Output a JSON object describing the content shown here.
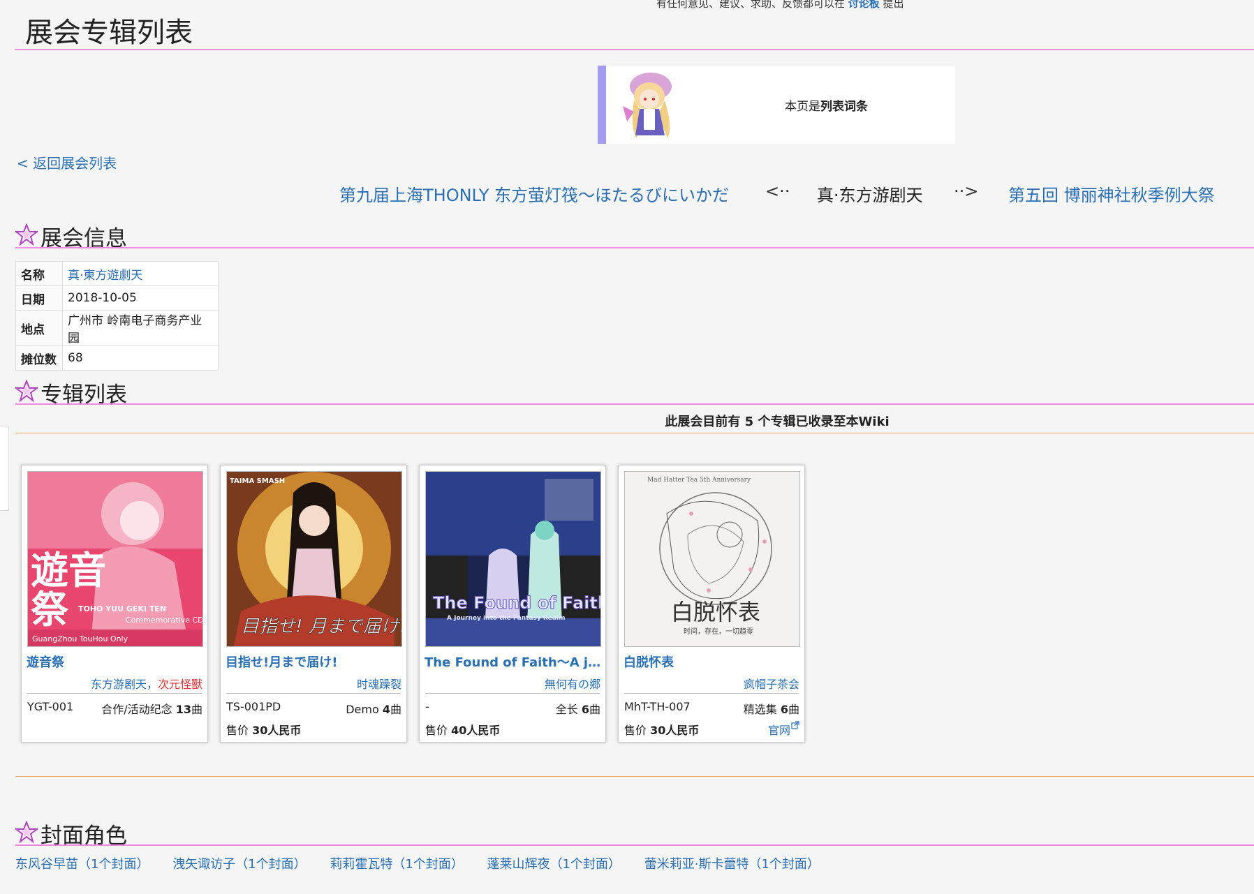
{
  "top_note": {
    "prefix": "有任何意见、建议、求助、反馈都可以在 ",
    "link": "讨论板",
    "suffix": " 提出"
  },
  "page_title": "展会专辑列表",
  "notice": {
    "prefix": "本页是",
    "bold": "列表词条"
  },
  "back_link": "< 返回展会列表",
  "event_chain": {
    "prev": "第九届上海THONLY 东方萤灯筏～ほたるびにいかだ",
    "prev_arrow": "<··",
    "current": "真·东方游剧天",
    "next_arrow": "··>",
    "next": "第五回 博丽神社秋季例大祭"
  },
  "section_info": {
    "heading": "展会信息"
  },
  "info_table": [
    {
      "key": "名称",
      "value": "真·東方遊劇天"
    },
    {
      "key": "日期",
      "value": "2018-10-05"
    },
    {
      "key": "地点",
      "value": "广州市 岭南电子商务产业园"
    },
    {
      "key": "摊位数",
      "value": "68"
    }
  ],
  "section_albums": {
    "heading": "专辑列表"
  },
  "album_count": {
    "prefix": "此展会目前有 ",
    "num": "5",
    "suffix": " 个专辑已收录至本Wiki"
  },
  "albums": [
    {
      "title": "遊音祭",
      "circle": "东方游剧天",
      "circle_sep": "，",
      "circle2": "次元怪獸",
      "catalog": "YGT-001",
      "type": "合作/活动纪念 ",
      "tracks": "13",
      "track_unit": "曲",
      "price_label": "",
      "price": "",
      "cover_text": [
        "遊音",
        "祭",
        "TOHO YUU GEKI TEN",
        "Commemorative CD",
        "GuangZhou TouHou Only"
      ]
    },
    {
      "title": "目指せ!月まで届け!",
      "circle": "时魂躁裂",
      "catalog": "TS-001PD",
      "type": "Demo ",
      "tracks": "4",
      "track_unit": "曲",
      "price_label": "售价 ",
      "price": "30人民币",
      "cover_text": [
        "TAIMA SMASH",
        "目指せ! 月まで届け!"
      ]
    },
    {
      "title": "The Found of Faith～A journey into the Fantasy Realm",
      "circle": "無何有の郷",
      "catalog": "-",
      "type": "全长 ",
      "tracks": "6",
      "track_unit": "曲",
      "price_label": "售价 ",
      "price": "40人民币",
      "cover_text": [
        "The Found of Faith",
        "A Journey into the Fantasy Realm"
      ]
    },
    {
      "title": "白脱怀表",
      "circle": "疯帽子茶会",
      "catalog": "MhT-TH-007",
      "type": "精选集 ",
      "tracks": "6",
      "track_unit": "曲",
      "price_label": "售价 ",
      "price": "30人民币",
      "site": "官网",
      "cover_text": [
        "Mad Hatter Tea 5th Anniversary",
        "白脱怀表",
        "时间，存在，一切趋零"
      ]
    }
  ],
  "section_chars": {
    "heading": "封面角色"
  },
  "characters": [
    {
      "name": "东风谷早苗",
      "count": "（1个封面）"
    },
    {
      "name": "洩矢诹访子",
      "count": "（1个封面）"
    },
    {
      "name": "莉莉霍瓦特",
      "count": "（1个封面）"
    },
    {
      "name": "蓬莱山辉夜",
      "count": "（1个封面）"
    },
    {
      "name": "蕾米莉亚·斯卡蕾特",
      "count": "（1个封面）"
    }
  ],
  "colors": {
    "heading_line": "#f08ae0",
    "section_line": "#e8a860",
    "link": "#2a6fb3",
    "notice_bar": "#a39cf0"
  }
}
